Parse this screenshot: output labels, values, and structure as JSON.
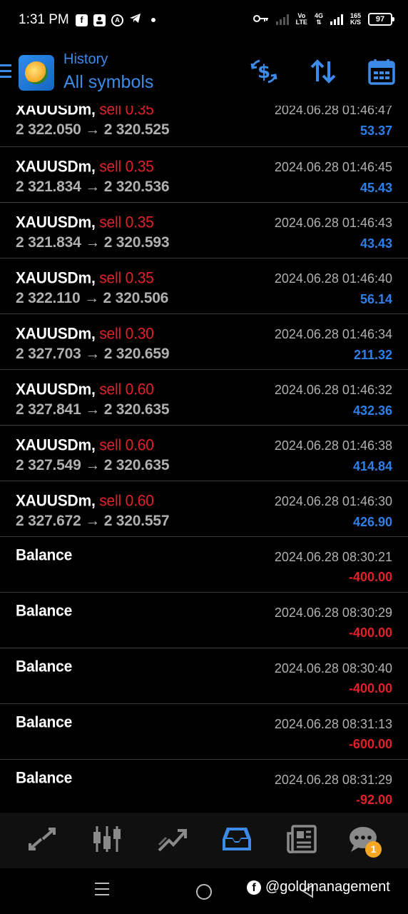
{
  "status_bar": {
    "time": "1:31 PM",
    "net_label_top": "Vo",
    "net_label_bottom": "LTE",
    "gen": "4G",
    "speed_top": "165",
    "speed_bottom": "K/S",
    "battery": "97"
  },
  "header": {
    "subtitle": "History",
    "title": "All symbols",
    "icons": [
      "hamburger-icon",
      "metatrader-logo",
      "dollar-exchange-icon",
      "sort-arrows-icon",
      "calendar-icon"
    ]
  },
  "trades": [
    {
      "symbol": "XAUUSDm,",
      "type": "sell 0.35",
      "prices": "2 322.050 → 2 320.525",
      "date": "2024.06.28 01:46:47",
      "profit": "53.37"
    },
    {
      "symbol": "XAUUSDm,",
      "type": "sell 0.35",
      "prices": "2 321.834 → 2 320.536",
      "date": "2024.06.28 01:46:45",
      "profit": "45.43"
    },
    {
      "symbol": "XAUUSDm,",
      "type": "sell 0.35",
      "prices": "2 321.834 → 2 320.593",
      "date": "2024.06.28 01:46:43",
      "profit": "43.43"
    },
    {
      "symbol": "XAUUSDm,",
      "type": "sell 0.35",
      "prices": "2 322.110 → 2 320.506",
      "date": "2024.06.28 01:46:40",
      "profit": "56.14"
    },
    {
      "symbol": "XAUUSDm,",
      "type": "sell 0.30",
      "prices": "2 327.703 → 2 320.659",
      "date": "2024.06.28 01:46:34",
      "profit": "211.32"
    },
    {
      "symbol": "XAUUSDm,",
      "type": "sell 0.60",
      "prices": "2 327.841 → 2 320.635",
      "date": "2024.06.28 01:46:32",
      "profit": "432.36"
    },
    {
      "symbol": "XAUUSDm,",
      "type": "sell 0.60",
      "prices": "2 327.549 → 2 320.635",
      "date": "2024.06.28 01:46:38",
      "profit": "414.84"
    },
    {
      "symbol": "XAUUSDm,",
      "type": "sell 0.60",
      "prices": "2 327.672 → 2 320.557",
      "date": "2024.06.28 01:46:30",
      "profit": "426.90"
    }
  ],
  "balances": [
    {
      "label": "Balance",
      "date": "2024.06.28 08:30:21",
      "amount": "-400.00"
    },
    {
      "label": "Balance",
      "date": "2024.06.28 08:30:29",
      "amount": "-400.00"
    },
    {
      "label": "Balance",
      "date": "2024.06.28 08:30:40",
      "amount": "-400.00"
    },
    {
      "label": "Balance",
      "date": "2024.06.28 08:31:13",
      "amount": "-600.00"
    },
    {
      "label": "Balance",
      "date": "2024.06.28 08:31:29",
      "amount": "-92.00"
    }
  ],
  "colors": {
    "accent": "#3d8be8",
    "sell": "#e0202a",
    "profit_positive": "#2f7fe8",
    "profit_negative": "#e0202a"
  },
  "tabs": [
    {
      "icon": "quotes-icon",
      "active": false
    },
    {
      "icon": "chart-icon",
      "active": false
    },
    {
      "icon": "trade-icon",
      "active": false
    },
    {
      "icon": "history-icon",
      "active": true
    },
    {
      "icon": "news-icon",
      "active": false
    },
    {
      "icon": "messages-icon",
      "active": false,
      "badge": "1"
    }
  ],
  "watermark": "@goldmanagement"
}
